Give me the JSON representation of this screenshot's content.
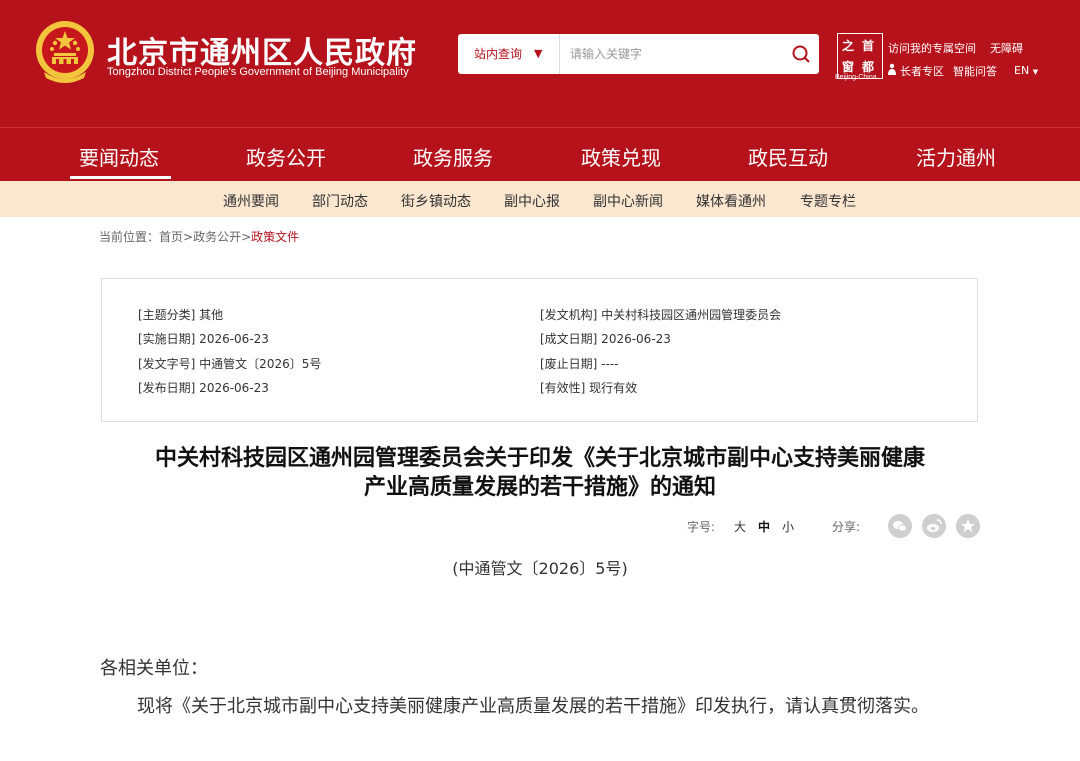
{
  "header": {
    "site_title_cn": "北京市通州区人民政府",
    "site_title_en": "Tongzhou District People's Government of Beijing Municipality",
    "search_scope": "站内查询",
    "search_placeholder": "请输入关键字",
    "seal_chars": [
      "之",
      "首",
      "窗",
      "都"
    ],
    "seal_caption": "Beijing-China",
    "links": {
      "my_space": "访问我的专属空间",
      "accessibility": "无障碍",
      "elder": "长者专区",
      "smart_qa": "智能问答",
      "lang": "EN"
    }
  },
  "nav": {
    "items": [
      "要闻动态",
      "政务公开",
      "政务服务",
      "政策兑现",
      "政民互动",
      "活力通州"
    ],
    "active": "要闻动态"
  },
  "subnav": {
    "items": [
      "通州要闻",
      "部门动态",
      "街乡镇动态",
      "副中心报",
      "副中心新闻",
      "媒体看通州",
      "专题专栏"
    ]
  },
  "breadcrumb": {
    "prefix": "当前位置：",
    "home": "首页",
    "sep": ">",
    "level1": "政务公开",
    "current": "政策文件"
  },
  "meta": {
    "topic": "[主题分类] 其他",
    "issuer": "[发文机构] 中关村科技园区通州园管理委员会",
    "effective_date": "[实施日期] 2026-06-23",
    "written_date": "[成文日期] 2026-06-23",
    "doc_number": "[发文字号] 中通管文〔2026〕5号",
    "repeal_date": "[废止日期] ----",
    "publish_date": "[发布日期] 2026-06-23",
    "validity": "[有效性] 现行有效"
  },
  "article": {
    "title_line1": "中关村科技园区通州园管理委员会关于印发《关于北京城市副中心支持美丽健康",
    "title_line2": "产业高质量发展的若干措施》的通知",
    "font_label": "字号:",
    "font_large": "大",
    "font_medium": "中",
    "font_small": "小",
    "share_label": "分享:",
    "doc_no": "(中通管文〔2026〕5号)",
    "salutation": "各相关单位：",
    "body": "现将《关于北京城市副中心支持美丽健康产业高质量发展的若干措施》印发执行，请认真贯彻落实。"
  },
  "colors": {
    "brand_red": "#b5121b",
    "subnav_bg": "#fbe6cf",
    "emblem_gold": "#f3c53c"
  },
  "icons": [
    "national-emblem-icon",
    "search-icon",
    "chevron-down-icon",
    "elder-person-icon",
    "wechat-icon",
    "weibo-icon",
    "favorite-star-icon"
  ]
}
